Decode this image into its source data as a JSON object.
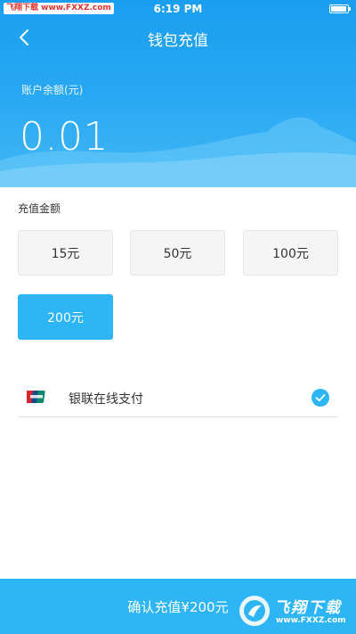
{
  "status_bar": {
    "watermark": "飞翔下载 www.FXXZ.com",
    "time": "6:19 PM"
  },
  "nav": {
    "title": "钱包充值"
  },
  "balance": {
    "label": "账户余额(元)",
    "value": "0.01"
  },
  "recharge": {
    "label": "充值金额",
    "options": [
      {
        "label": "15元",
        "selected": false
      },
      {
        "label": "50元",
        "selected": false
      },
      {
        "label": "100元",
        "selected": false
      },
      {
        "label": "200元",
        "selected": true
      }
    ]
  },
  "payment": {
    "method": "银联在线支付",
    "icon": "unionpay-icon",
    "checked": true
  },
  "footer": {
    "confirm": "确认充值¥200元",
    "watermark_text": "飞翔下载",
    "watermark_url": "www.FXXZ.com"
  },
  "colors": {
    "accent": "#2eb5f5",
    "header": "#1a9ef0"
  }
}
